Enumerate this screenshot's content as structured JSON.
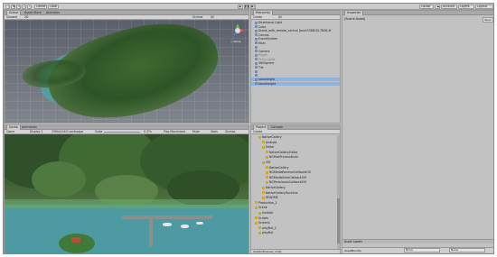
{
  "toolbar": {
    "left_buttons": [
      "Center",
      "Local"
    ],
    "right_buttons": [
      "Collab",
      "Account",
      "Layers",
      "Layout"
    ]
  },
  "scene_panel": {
    "tabs": [
      "Scene",
      "Asset Store",
      "Animator"
    ],
    "subbar": {
      "shading": "Shaded",
      "mode": "2D",
      "gizmos": "Gizmos",
      "search": "All"
    },
    "persp_label": "< Persp"
  },
  "hierarchy_panel": {
    "tab": "Hierarchy",
    "create": "Create",
    "search": "All",
    "items": [
      {
        "label": "Directional Light",
        "style": "normal"
      },
      {
        "label": "Cube",
        "style": "normal"
      },
      {
        "label": "Drone_with_remote_control [bush338DCN-7836-4f",
        "style": "normal"
      },
      {
        "label": "Canvas",
        "style": "normal"
      },
      {
        "label": "EventSystem",
        "style": "normal"
      },
      {
        "label": "Main",
        "style": "normal"
      },
      {
        "label": "",
        "style": "normal"
      },
      {
        "label": "Camera",
        "style": "normal"
      },
      {
        "label": "Player",
        "style": "gray"
      },
      {
        "label": "Point Lights",
        "style": "gray"
      },
      {
        "label": "360Sphere",
        "style": "normal"
      },
      {
        "label": "Tile",
        "style": "normal"
      },
      {
        "label": "",
        "style": "normal"
      },
      {
        "label": "",
        "style": "normal"
      },
      {
        "label": "stoneleight",
        "style": "sel"
      },
      {
        "label": "stoneheight",
        "style": "sel"
      }
    ]
  },
  "inspector_panel": {
    "tab": "Inspector",
    "object": "(Scene Asset)",
    "open": "Open",
    "asset_labels": "Asset Labels",
    "asset_bundle": "AssetBundle",
    "none_1": "None",
    "none_2": "None"
  },
  "game_panel": {
    "tabs": [
      "Game",
      "Animation"
    ],
    "subbar": {
      "display": "Game",
      "display2": "Display 1",
      "resolution": "2560x1440 Landscape",
      "scale": "Scale",
      "scale_val": "0.37x",
      "maximize": "Play Maximized",
      "mute": "Mute",
      "stats": "Stats",
      "gizmos": "Gizmos"
    }
  },
  "project_panel": {
    "tabs": [
      "Project",
      "Console"
    ],
    "create": "Create",
    "items": [
      {
        "label": "NativeGallery",
        "indent": 2
      },
      {
        "label": "Android",
        "indent": 3
      },
      {
        "label": "Editor",
        "indent": 3
      },
      {
        "label": "NativeGallery.Editor",
        "indent": 4
      },
      {
        "label": "NGPostProcessBuild",
        "indent": 4
      },
      {
        "label": "iOS",
        "indent": 3
      },
      {
        "label": "NativeGallery",
        "indent": 4
      },
      {
        "label": "NGMediaReceiveCallbackiOS",
        "indent": 4
      },
      {
        "label": "NGMediaSaveCallbackiOS",
        "indent": 4
      },
      {
        "label": "NGPermissionCallbackiOS",
        "indent": 4
      },
      {
        "label": "NativeGallery",
        "indent": 3
      },
      {
        "label": "NativeGallery.Runtime",
        "indent": 3
      },
      {
        "label": "README",
        "indent": 3
      },
      {
        "label": "Production_2",
        "indent": 1
      },
      {
        "label": "Scene",
        "indent": 1
      },
      {
        "label": "Instiate",
        "indent": 2
      },
      {
        "label": "Scripts",
        "indent": 1
      },
      {
        "label": "Screens",
        "indent": 1
      },
      {
        "label": "playBut_2",
        "indent": 2
      },
      {
        "label": "playBut",
        "indent": 2
      }
    ],
    "path": "Assets/Scenes/_unity"
  },
  "colors": {
    "chrome": "#c2c2c2",
    "tabbar": "#a8a8a8",
    "selection": "#8fb2e0",
    "link_blue": "#1d4fd6"
  },
  "icons": [
    "hand-tool-icon",
    "move-tool-icon",
    "rotate-tool-icon",
    "scale-tool-icon",
    "rect-tool-icon",
    "play-icon",
    "pause-icon",
    "step-icon",
    "cloud-icon",
    "lock-icon",
    "menu-icon",
    "folder-icon",
    "gizmo-axis-icon"
  ]
}
